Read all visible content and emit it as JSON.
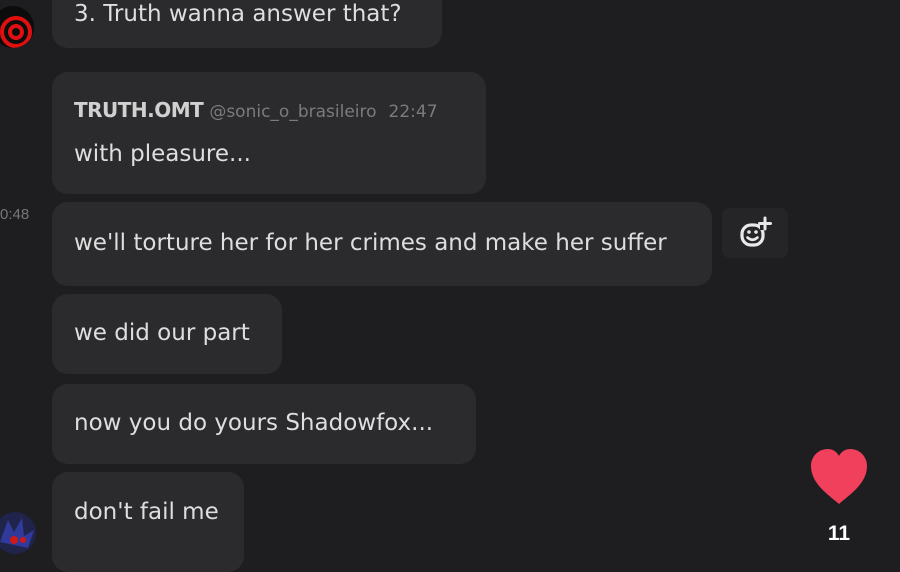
{
  "chat": {
    "messages": [
      {
        "text": "3. Truth wanna answer that?"
      },
      {
        "sender": "TRUTH.OMT",
        "handle": "@sonic_o_brasileiro",
        "time": "22:47",
        "text": "with pleasure..."
      },
      {
        "text": "we'll torture her for her crimes and make her suffer"
      },
      {
        "text": "we did our part"
      },
      {
        "text": "now you do yours Shadowfox..."
      },
      {
        "text": "don't fail me"
      }
    ],
    "side_timestamp": "0:48"
  },
  "actions": {
    "add_reaction_icon": "emoji-add-icon",
    "like_icon": "heart-icon",
    "like_count": "11"
  },
  "colors": {
    "background": "#1e1e20",
    "bubble": "#2b2b2e",
    "heart": "#f0405c",
    "avatar_ring": "#e01010"
  }
}
